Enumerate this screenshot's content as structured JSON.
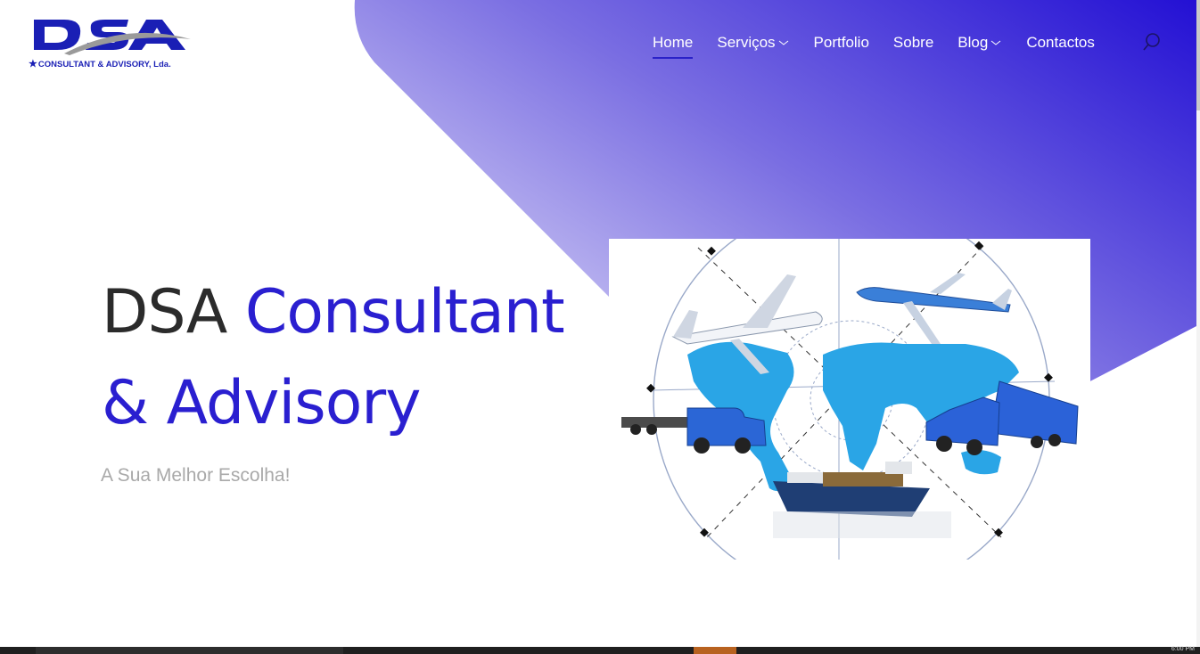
{
  "brand": {
    "logo_main": "DSA",
    "logo_sub": "CONSULTANT & ADVISORY, Lda.",
    "brand_color": "#1a1fb5"
  },
  "nav": {
    "items": [
      {
        "label": "Home",
        "active": true,
        "dropdown": false
      },
      {
        "label": "Serviços",
        "active": false,
        "dropdown": true
      },
      {
        "label": "Portfolio",
        "active": false,
        "dropdown": false
      },
      {
        "label": "Sobre",
        "active": false,
        "dropdown": false
      },
      {
        "label": "Blog",
        "active": false,
        "dropdown": true
      },
      {
        "label": "Contactos",
        "active": false,
        "dropdown": false
      }
    ],
    "search_icon": "search-icon"
  },
  "hero": {
    "title_plain": "DSA ",
    "title_accent_1": "Consultant",
    "title_accent_2": "& Advisory",
    "subtitle": "A Sua Melhor Escolha!",
    "accent_color": "#2a1fd0",
    "gradient_from": "#e9e7fb",
    "gradient_to": "#2a16d6"
  },
  "taskbar": {
    "clock": "6:00 PM"
  }
}
